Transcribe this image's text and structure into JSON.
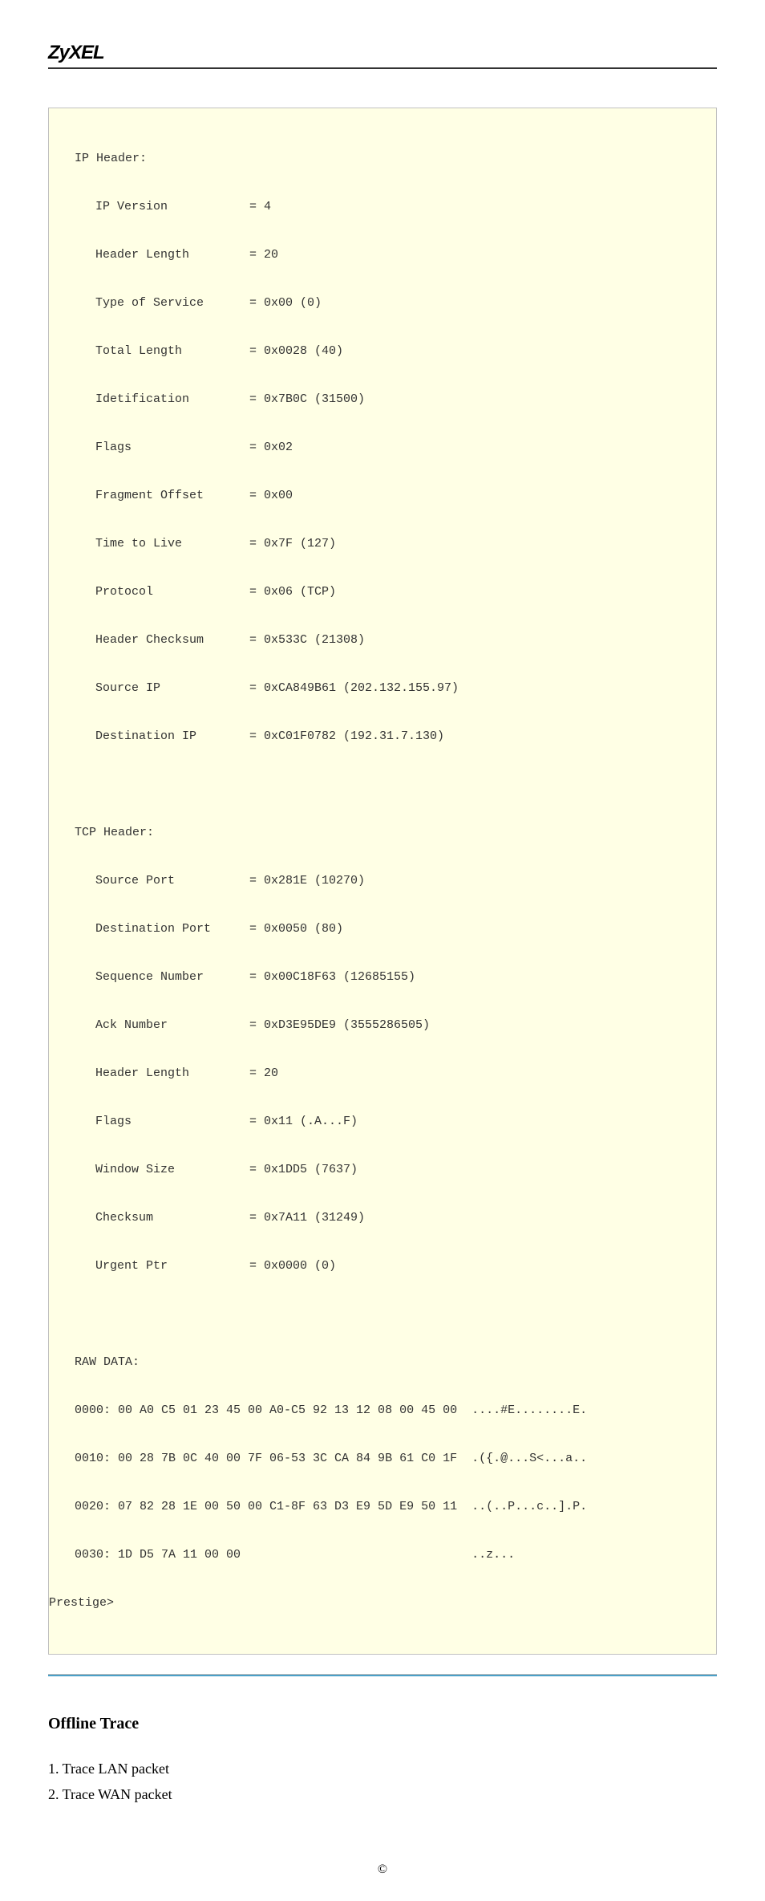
{
  "logo": "ZyXEL",
  "packet": {
    "ip_header_title": "IP Header:",
    "ip_fields": [
      {
        "label": "IP Version",
        "value": "= 4"
      },
      {
        "label": "Header Length",
        "value": "= 20"
      },
      {
        "label": "Type of Service",
        "value": "= 0x00 (0)"
      },
      {
        "label": "Total Length",
        "value": "= 0x0028 (40)"
      },
      {
        "label": "Idetification",
        "value": "= 0x7B0C (31500)"
      },
      {
        "label": "Flags",
        "value": "= 0x02"
      },
      {
        "label": "Fragment Offset",
        "value": "= 0x00"
      },
      {
        "label": "Time to Live",
        "value": "= 0x7F (127)"
      },
      {
        "label": "Protocol",
        "value": "= 0x06 (TCP)"
      },
      {
        "label": "Header Checksum",
        "value": "= 0x533C (21308)"
      },
      {
        "label": "Source IP",
        "value": "= 0xCA849B61 (202.132.155.97)"
      },
      {
        "label": "Destination IP",
        "value": "= 0xC01F0782 (192.31.7.130)"
      }
    ],
    "tcp_header_title": "TCP Header:",
    "tcp_fields": [
      {
        "label": "Source Port",
        "value": "= 0x281E (10270)"
      },
      {
        "label": "Destination Port",
        "value": "= 0x0050 (80)"
      },
      {
        "label": "Sequence Number",
        "value": "= 0x00C18F63 (12685155)"
      },
      {
        "label": "Ack Number",
        "value": "= 0xD3E95DE9 (3555286505)"
      },
      {
        "label": "Header Length",
        "value": "= 20"
      },
      {
        "label": "Flags",
        "value": "= 0x11 (.A...F)"
      },
      {
        "label": "Window Size",
        "value": "= 0x1DD5 (7637)"
      },
      {
        "label": "Checksum",
        "value": "= 0x7A11 (31249)"
      },
      {
        "label": "Urgent Ptr",
        "value": "= 0x0000 (0)"
      }
    ],
    "raw_title": "RAW DATA:",
    "raw_lines": [
      "0000: 00 A0 C5 01 23 45 00 A0-C5 92 13 12 08 00 45 00  ....#E........E.",
      "0010: 00 28 7B 0C 40 00 7F 06-53 3C CA 84 9B 61 C0 1F  .({.@...S<...a..",
      "0020: 07 82 28 1E 00 50 00 C1-8F 63 D3 E9 5D E9 50 11  ..(..P...c..].P.",
      "0030: 1D D5 7A 11 00 00                                ..z...          "
    ],
    "prompt": "Prestige>"
  },
  "offline": {
    "heading": "Offline Trace",
    "items": [
      "1. Trace LAN packet",
      "2. Trace WAN packet"
    ]
  },
  "footer": "©"
}
